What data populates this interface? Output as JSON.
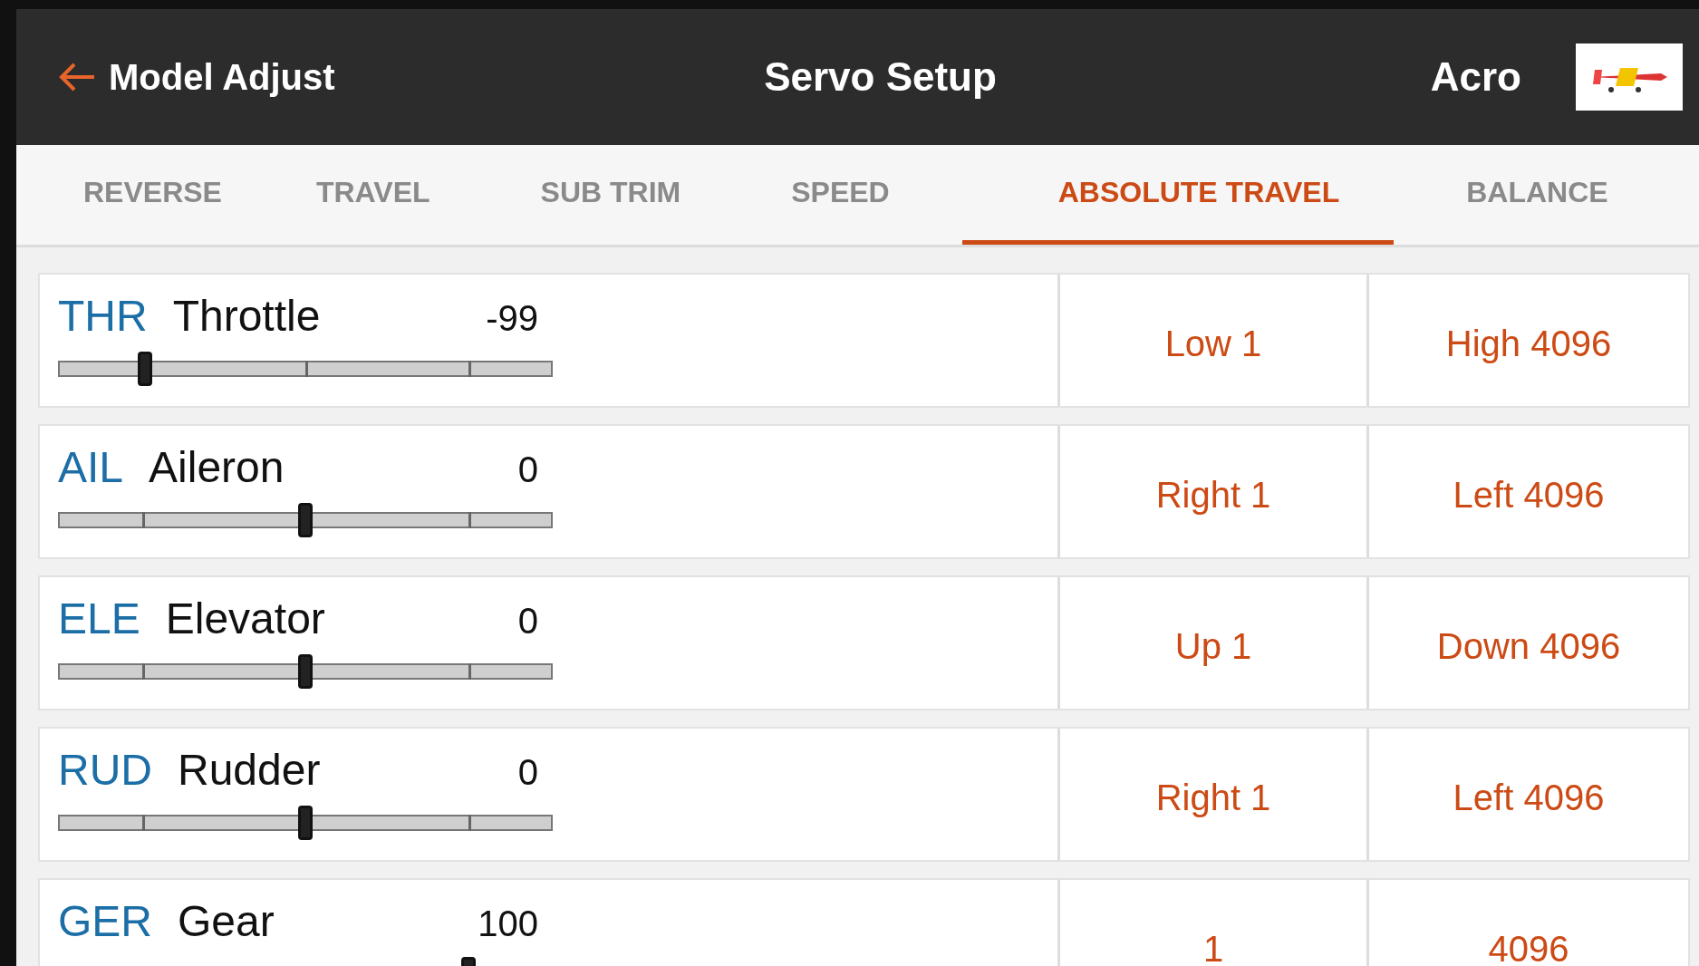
{
  "header": {
    "back_label": "Model Adjust",
    "title": "Servo Setup",
    "model_name": "Acro"
  },
  "tabs": [
    {
      "label": "REVERSE",
      "selected": false
    },
    {
      "label": "TRAVEL",
      "selected": false
    },
    {
      "label": "SUB TRIM",
      "selected": false
    },
    {
      "label": "SPEED",
      "selected": false
    },
    {
      "label": "ABSOLUTE TRAVEL",
      "selected": true
    },
    {
      "label": "BALANCE",
      "selected": false
    }
  ],
  "channels": [
    {
      "code": "THR",
      "name": "Throttle",
      "value": "-99",
      "level": 0.175,
      "low": "Low 1",
      "high": "High 4096"
    },
    {
      "code": "AIL",
      "name": "Aileron",
      "value": "0",
      "level": 0.5,
      "low": "Right 1",
      "high": "Left 4096"
    },
    {
      "code": "ELE",
      "name": "Elevator",
      "value": "0",
      "level": 0.5,
      "low": "Up 1",
      "high": "Down 4096"
    },
    {
      "code": "RUD",
      "name": "Rudder",
      "value": "0",
      "level": 0.5,
      "low": "Right 1",
      "high": "Left 4096"
    },
    {
      "code": "GER",
      "name": "Gear",
      "value": "100",
      "level": 0.83,
      "low": "1",
      "high": "4096"
    }
  ]
}
